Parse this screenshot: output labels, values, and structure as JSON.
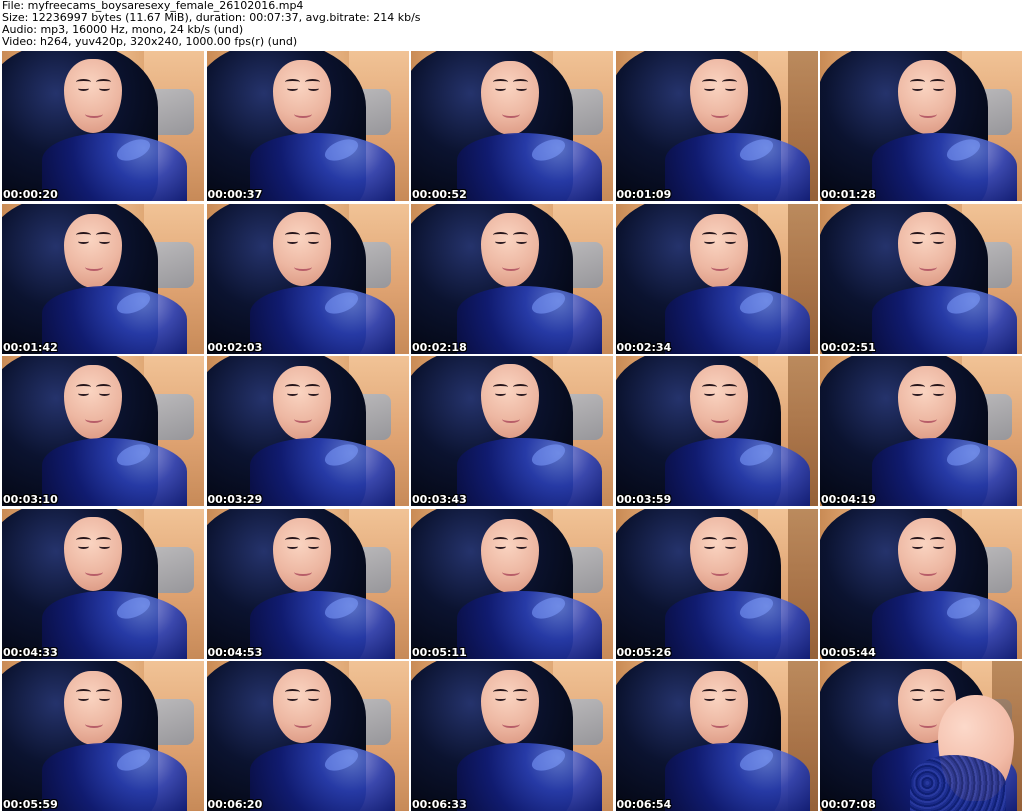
{
  "header": {
    "file": "File: myfreecams_boysaresexy_female_26102016.mp4",
    "size": "Size: 12236997 bytes (11.67 MiB), duration: 00:07:37, avg.bitrate: 214 kb/s",
    "audio": "Audio: mp3, 16000 Hz, mono, 24 kb/s (und)",
    "video": "Video: h264, yuv420p, 320x240, 1000.00 fps(r) (und)"
  },
  "thumbnails": [
    {
      "time": "00:00:20"
    },
    {
      "time": "00:00:37"
    },
    {
      "time": "00:00:52"
    },
    {
      "time": "00:01:09"
    },
    {
      "time": "00:01:28"
    },
    {
      "time": "00:01:42"
    },
    {
      "time": "00:02:03"
    },
    {
      "time": "00:02:18"
    },
    {
      "time": "00:02:34"
    },
    {
      "time": "00:02:51"
    },
    {
      "time": "00:03:10"
    },
    {
      "time": "00:03:29"
    },
    {
      "time": "00:03:43"
    },
    {
      "time": "00:03:59"
    },
    {
      "time": "00:04:19"
    },
    {
      "time": "00:04:33"
    },
    {
      "time": "00:04:53"
    },
    {
      "time": "00:05:11"
    },
    {
      "time": "00:05:26"
    },
    {
      "time": "00:05:44"
    },
    {
      "time": "00:05:59"
    },
    {
      "time": "00:06:20"
    },
    {
      "time": "00:06:33"
    },
    {
      "time": "00:06:54"
    },
    {
      "time": "00:07:08"
    }
  ]
}
